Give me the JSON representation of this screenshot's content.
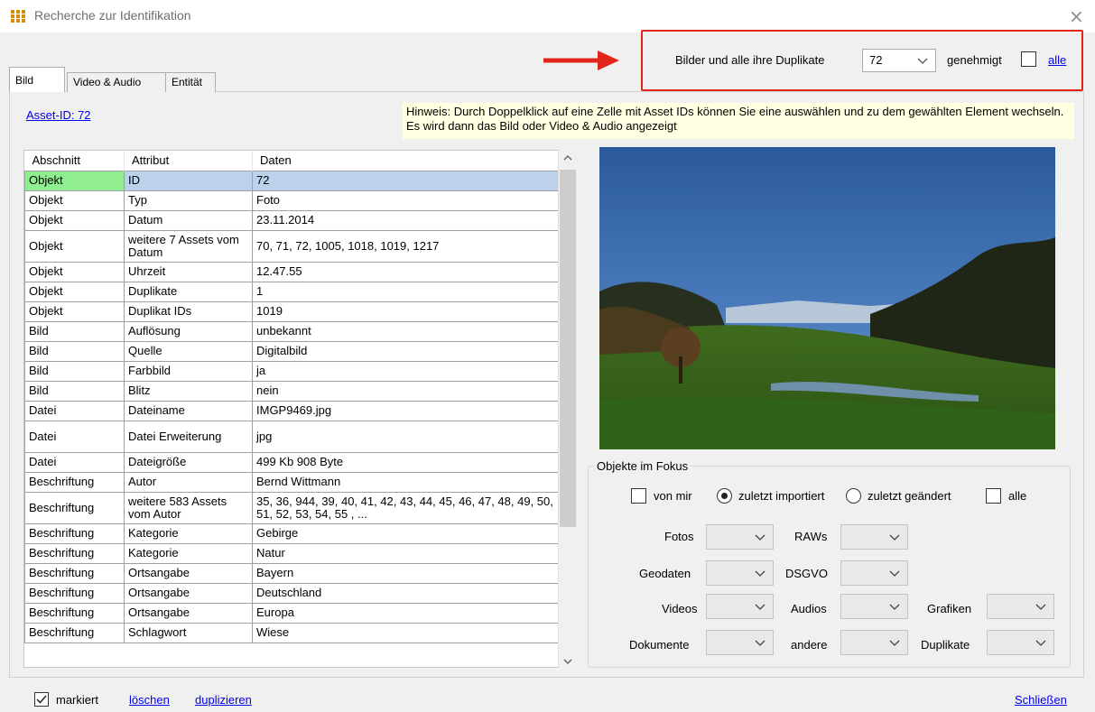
{
  "window": {
    "title": "Recherche zur Identifikation",
    "close_glyph": "×"
  },
  "duplicates": {
    "label": "Bilder und alle ihre Duplikate",
    "selected_value": "72",
    "genehmigt_label": "genehmigt",
    "genehmigt_checked": false,
    "alle_link": "alle"
  },
  "tabs": [
    {
      "label": "Bild",
      "active": true
    },
    {
      "label": "Video & Audio",
      "active": false
    },
    {
      "label": "Entität",
      "active": false
    }
  ],
  "asset_link": "Asset-ID: 72",
  "hint": "Hinweis: Durch Doppelklick auf eine Zelle mit Asset IDs können Sie eine auswählen und zu dem gewählten Element wechseln. Es wird dann das Bild oder Video & Audio angezeigt",
  "grid": {
    "headers": [
      "Abschnitt",
      "Attribut",
      "Daten"
    ],
    "rows": [
      [
        "Objekt",
        "ID",
        "72"
      ],
      [
        "Objekt",
        "Typ",
        "Foto"
      ],
      [
        "Objekt",
        "Datum",
        "23.11.2014"
      ],
      [
        "Objekt",
        "weitere 7 Assets vom Datum",
        "70, 71, 72, 1005, 1018, 1019, 1217"
      ],
      [
        "Objekt",
        "Uhrzeit",
        "12.47.55"
      ],
      [
        "Objekt",
        "Duplikate",
        "1"
      ],
      [
        "Objekt",
        "Duplikat IDs",
        "1019"
      ],
      [
        "Bild",
        "Auflösung",
        "unbekannt"
      ],
      [
        "Bild",
        "Quelle",
        "Digitalbild"
      ],
      [
        "Bild",
        "Farbbild",
        "ja"
      ],
      [
        "Bild",
        "Blitz",
        "nein"
      ],
      [
        "Datei",
        "Dateiname",
        "IMGP9469.jpg"
      ],
      [
        "Datei",
        "Datei Erweiterung",
        "jpg"
      ],
      [
        "Datei",
        "Dateigröße",
        "499 Kb 908 Byte"
      ],
      [
        "Beschriftung",
        "Autor",
        "Bernd Wittmann"
      ],
      [
        "Beschriftung",
        "weitere 583 Assets vom Autor",
        "35, 36, 944, 39, 40, 41, 42, 43, 44, 45, 46, 47, 48, 49, 50, 51, 52, 53, 54, 55 , ..."
      ],
      [
        "Beschriftung",
        "Kategorie",
        "Gebirge"
      ],
      [
        "Beschriftung",
        "Kategorie",
        "Natur"
      ],
      [
        "Beschriftung",
        "Ortsangabe",
        "Bayern"
      ],
      [
        "Beschriftung",
        "Ortsangabe",
        "Deutschland"
      ],
      [
        "Beschriftung",
        "Ortsangabe",
        "Europa"
      ],
      [
        "Beschriftung",
        "Schlagwort",
        "Wiese"
      ]
    ],
    "selected_row": 0
  },
  "focus": {
    "title": "Objekte im Fokus",
    "von_mir": "von mir",
    "zuletzt_importiert": "zuletzt importiert",
    "zuletzt_geaendert": "zuletzt geändert",
    "alle": "alle",
    "selected_radio": "zuletzt importiert",
    "filters": {
      "fotos": "Fotos",
      "raws": "RAWs",
      "geodaten": "Geodaten",
      "dsgvo": "DSGVO",
      "videos": "Videos",
      "audios": "Audios",
      "grafiken": "Grafiken",
      "dokumente": "Dokumente",
      "andere": "andere",
      "duplikate": "Duplikate"
    }
  },
  "footer": {
    "markiert": "markiert",
    "markiert_checked": true,
    "loeschen": "löschen",
    "duplizieren": "duplizieren",
    "schliessen": "Schließen"
  },
  "colors": {
    "highlight_box": "#e1251b",
    "selected_cell": "#90ee90",
    "selected_row": "#bcd1ea",
    "hint_bg": "#ffffe1",
    "link": "#0000ee"
  }
}
